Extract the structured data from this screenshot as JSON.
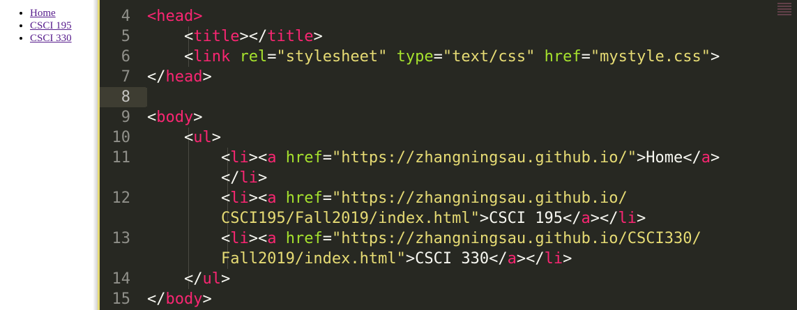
{
  "preview": {
    "links": [
      {
        "label": "Home"
      },
      {
        "label": "CSCI 195"
      },
      {
        "label": "CSCI 330"
      }
    ]
  },
  "editor": {
    "rows": [
      {
        "line": "4",
        "parts": [
          [
            "tag",
            "<head>"
          ]
        ]
      },
      {
        "line": "5",
        "parts": [
          [
            "plain",
            "    <"
          ],
          [
            "tag",
            "title"
          ],
          [
            "plain",
            "></"
          ],
          [
            "tag",
            "title"
          ],
          [
            "plain",
            ">"
          ]
        ]
      },
      {
        "line": "6",
        "parts": [
          [
            "plain",
            "    <"
          ],
          [
            "tag",
            "link"
          ],
          [
            "plain",
            " "
          ],
          [
            "attr",
            "rel"
          ],
          [
            "plain",
            "="
          ],
          [
            "str",
            "\"stylesheet\""
          ],
          [
            "plain",
            " "
          ],
          [
            "attr",
            "type"
          ],
          [
            "plain",
            "="
          ],
          [
            "str",
            "\"text/css\""
          ],
          [
            "plain",
            " "
          ],
          [
            "attr",
            "href"
          ],
          [
            "plain",
            "="
          ],
          [
            "str",
            "\"mystyle.css\""
          ],
          [
            "plain",
            ">"
          ]
        ]
      },
      {
        "line": "7",
        "parts": [
          [
            "plain",
            "</"
          ],
          [
            "tag",
            "head"
          ],
          [
            "plain",
            ">"
          ]
        ]
      },
      {
        "line": "8",
        "parts": [],
        "current": true
      },
      {
        "line": "9",
        "parts": [
          [
            "plain",
            "<"
          ],
          [
            "tag",
            "body"
          ],
          [
            "plain",
            ">"
          ]
        ]
      },
      {
        "line": "10",
        "parts": [
          [
            "plain",
            "    <"
          ],
          [
            "tag",
            "ul"
          ],
          [
            "plain",
            ">"
          ]
        ]
      },
      {
        "line": "11",
        "parts": [
          [
            "plain",
            "        <"
          ],
          [
            "tag",
            "li"
          ],
          [
            "plain",
            "><"
          ],
          [
            "tag",
            "a"
          ],
          [
            "plain",
            " "
          ],
          [
            "attr",
            "href"
          ],
          [
            "plain",
            "="
          ],
          [
            "str",
            "\"https://zhangningsau.github.io/\""
          ],
          [
            "plain",
            ">Home</"
          ],
          [
            "tag",
            "a"
          ],
          [
            "plain",
            ">"
          ]
        ]
      },
      {
        "line": "",
        "parts": [
          [
            "plain",
            "        </"
          ],
          [
            "tag",
            "li"
          ],
          [
            "plain",
            ">"
          ]
        ]
      },
      {
        "line": "12",
        "parts": [
          [
            "plain",
            "        <"
          ],
          [
            "tag",
            "li"
          ],
          [
            "plain",
            "><"
          ],
          [
            "tag",
            "a"
          ],
          [
            "plain",
            " "
          ],
          [
            "attr",
            "href"
          ],
          [
            "plain",
            "="
          ],
          [
            "str",
            "\"https://zhangningsau.github.io/"
          ]
        ]
      },
      {
        "line": "",
        "parts": [
          [
            "str",
            "        CSCI195/Fall2019/index.html\""
          ],
          [
            "plain",
            ">CSCI 195</"
          ],
          [
            "tag",
            "a"
          ],
          [
            "plain",
            "></"
          ],
          [
            "tag",
            "li"
          ],
          [
            "plain",
            ">"
          ]
        ]
      },
      {
        "line": "13",
        "parts": [
          [
            "plain",
            "        <"
          ],
          [
            "tag",
            "li"
          ],
          [
            "plain",
            "><"
          ],
          [
            "tag",
            "a"
          ],
          [
            "plain",
            " "
          ],
          [
            "attr",
            "href"
          ],
          [
            "plain",
            "="
          ],
          [
            "str",
            "\"https://zhangningsau.github.io/CSCI330/"
          ]
        ]
      },
      {
        "line": "",
        "parts": [
          [
            "str",
            "        Fall2019/index.html\""
          ],
          [
            "plain",
            ">CSCI 330</"
          ],
          [
            "tag",
            "a"
          ],
          [
            "plain",
            "></"
          ],
          [
            "tag",
            "li"
          ],
          [
            "plain",
            ">"
          ]
        ]
      },
      {
        "line": "14",
        "parts": [
          [
            "plain",
            "    </"
          ],
          [
            "tag",
            "ul"
          ],
          [
            "plain",
            ">"
          ]
        ]
      },
      {
        "line": "15",
        "parts": [
          [
            "plain",
            "</"
          ],
          [
            "tag",
            "body"
          ],
          [
            "plain",
            ">"
          ]
        ]
      }
    ]
  },
  "colors": {
    "editor_bg": "#272822",
    "tag": "#f92672",
    "attr": "#a6e22e",
    "string": "#e6db74",
    "plain": "#f8f8f2",
    "gutter": "#90908a",
    "link": "#551a8b"
  }
}
